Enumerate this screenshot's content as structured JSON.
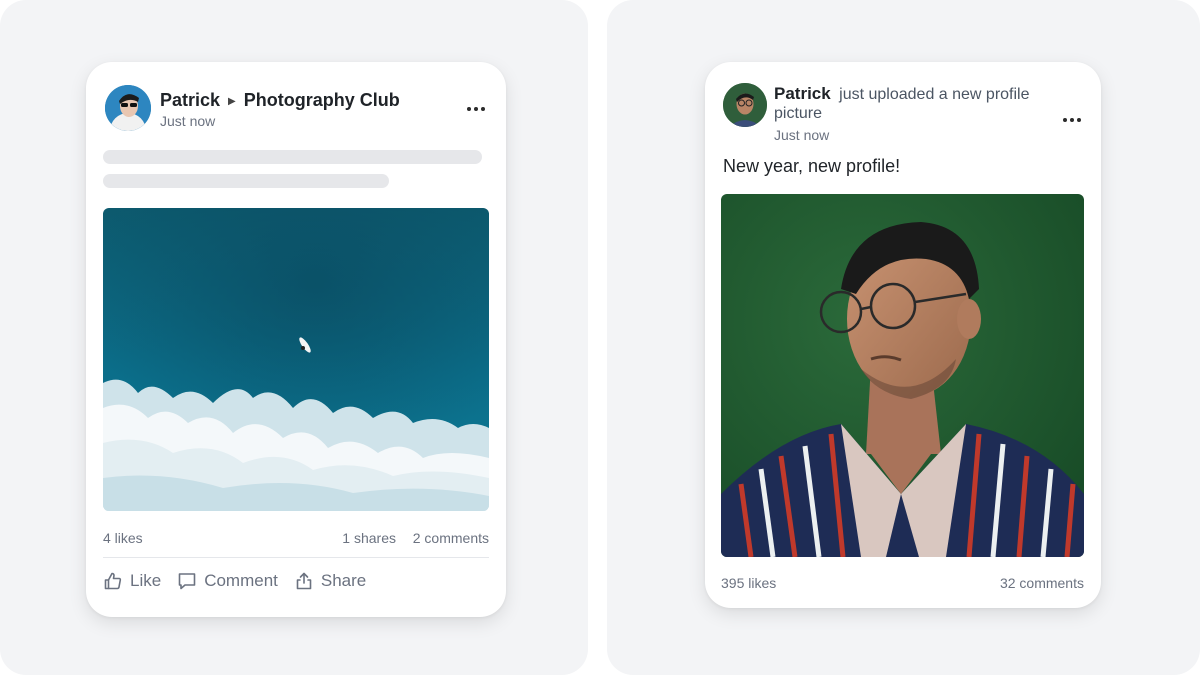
{
  "colors": {
    "panel_bg": "#f3f4f6",
    "card_bg": "#ffffff",
    "muted_text": "#6b7280",
    "skeleton": "#e6e7ea"
  },
  "post_one": {
    "author": "Patrick",
    "separator_icon": "triangle-right-icon",
    "group": "Photography Club",
    "time": "Just now",
    "image_alt": "aerial-ocean-surfer-photo",
    "likes": "4 likes",
    "shares": "1 shares",
    "comments": "2 comments",
    "actions": [
      {
        "label": "Like",
        "icon": "thumbs-up-icon"
      },
      {
        "label": "Comment",
        "icon": "comment-icon"
      },
      {
        "label": "Share",
        "icon": "share-icon"
      }
    ]
  },
  "post_two": {
    "author": "Patrick",
    "activity": "just uploaded a new profile picture",
    "time": "Just now",
    "caption": "New year, new profile!",
    "image_alt": "portrait-photo",
    "likes": "395 likes",
    "comments": "32 comments"
  }
}
